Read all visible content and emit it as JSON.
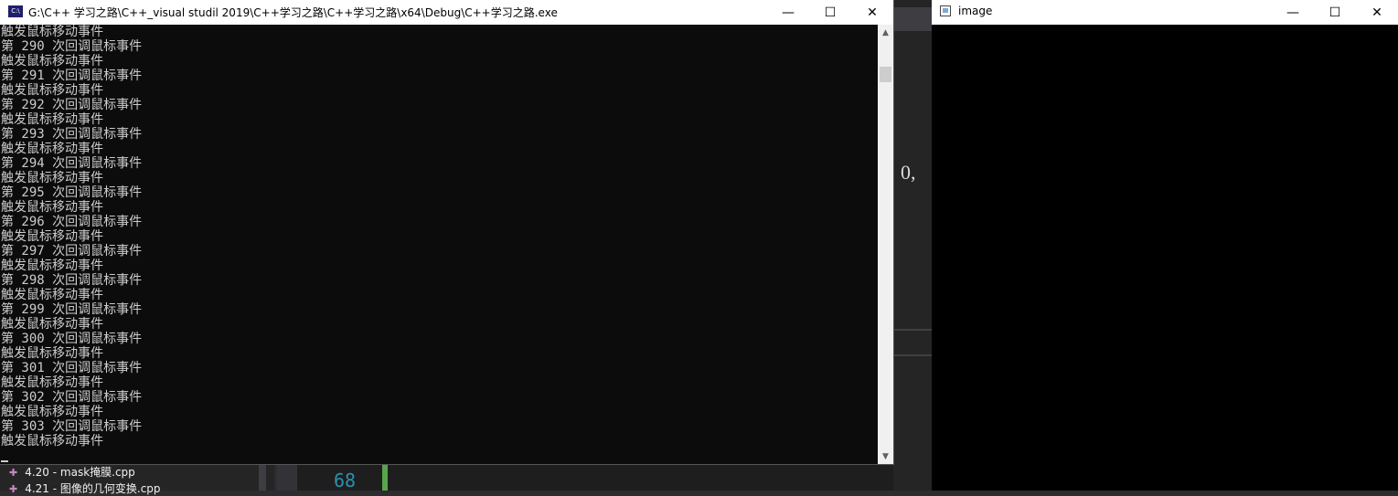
{
  "console": {
    "title": "G:\\C++ 学习之路\\C++_visual studil 2019\\C++学习之路\\C++学习之路\\x64\\Debug\\C++学习之路.exe",
    "icon_label": "C:\\",
    "lines": [
      "触发鼠标移动事件",
      "第 290 次回调鼠标事件",
      "触发鼠标移动事件",
      "第 291 次回调鼠标事件",
      "触发鼠标移动事件",
      "第 292 次回调鼠标事件",
      "触发鼠标移动事件",
      "第 293 次回调鼠标事件",
      "触发鼠标移动事件",
      "第 294 次回调鼠标事件",
      "触发鼠标移动事件",
      "第 295 次回调鼠标事件",
      "触发鼠标移动事件",
      "第 296 次回调鼠标事件",
      "触发鼠标移动事件",
      "第 297 次回调鼠标事件",
      "触发鼠标移动事件",
      "第 298 次回调鼠标事件",
      "触发鼠标移动事件",
      "第 299 次回调鼠标事件",
      "触发鼠标移动事件",
      "第 300 次回调鼠标事件",
      "触发鼠标移动事件",
      "第 301 次回调鼠标事件",
      "触发鼠标移动事件",
      "第 302 次回调鼠标事件",
      "触发鼠标移动事件",
      "第 303 次回调鼠标事件",
      "触发鼠标移动事件"
    ]
  },
  "image_window": {
    "title": "image"
  },
  "caption_buttons": {
    "minimize": "—",
    "maximize": "☐",
    "close": "✕"
  },
  "ide": {
    "code_fragment": "0,",
    "solution_items": [
      "4.20 - mask掩膜.cpp",
      "4.21 - 图像的几何变换.cpp"
    ],
    "line_number": "68"
  },
  "colors": {
    "console_bg": "#0c0c0c",
    "console_text": "#cccccc",
    "ide_bg": "#2d2d30"
  }
}
